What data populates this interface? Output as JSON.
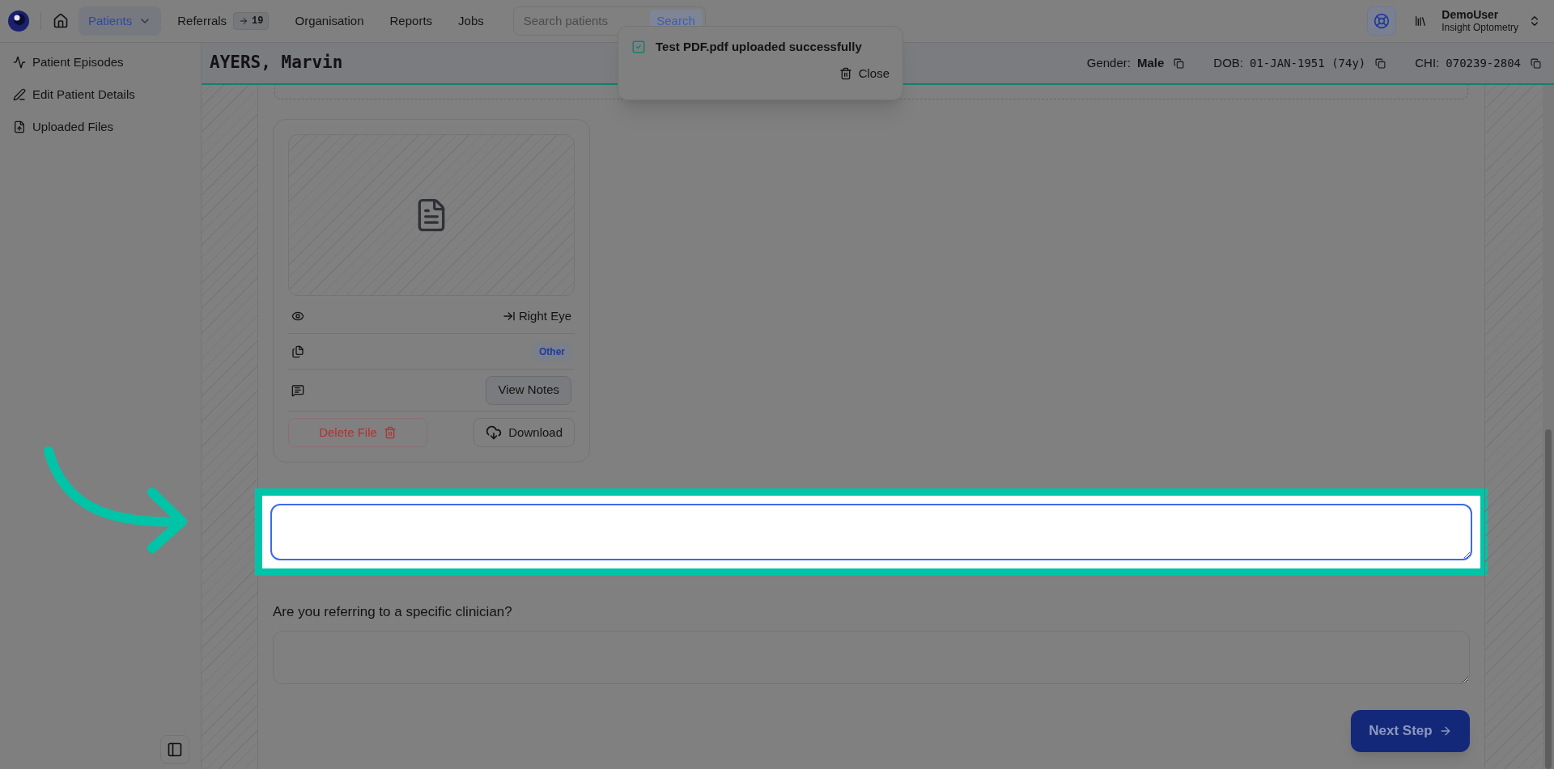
{
  "nav": {
    "items": [
      {
        "label": "Patients",
        "selected": true,
        "kind": "dropdown"
      },
      {
        "label": "Referrals",
        "selected": false,
        "kind": "counter",
        "count": "19"
      },
      {
        "label": "Organisation",
        "selected": false,
        "kind": "plain"
      },
      {
        "label": "Reports",
        "selected": false,
        "kind": "plain"
      },
      {
        "label": "Jobs",
        "selected": false,
        "kind": "plain"
      }
    ]
  },
  "search": {
    "placeholder": "Search patients",
    "button": "Search"
  },
  "user": {
    "name": "DemoUser",
    "organisation": "Insight Optometry"
  },
  "toast": {
    "message": "Test PDF.pdf uploaded successfully",
    "action": "Close"
  },
  "sidebar": {
    "items": [
      {
        "label": "Patient Episodes"
      },
      {
        "label": "Edit Patient Details"
      },
      {
        "label": "Uploaded Files"
      }
    ]
  },
  "patient": {
    "name": "AYERS, Marvin",
    "fields": [
      {
        "label": "Gender:",
        "value": "Male"
      },
      {
        "label": "DOB:",
        "value": "01-JAN-1951 (74y)"
      },
      {
        "label": "CHI:",
        "value": "070239-2804"
      }
    ]
  },
  "file_card": {
    "side": "Right Eye",
    "category": "Other",
    "notes_button": "View Notes",
    "delete_button": "Delete File",
    "download_button": "Download"
  },
  "assessment_notes": {
    "focused": true,
    "highlighted": true
  },
  "clinician_question": {
    "label": "Are you referring to a specific clinician?"
  },
  "next_button": "Next Step"
}
